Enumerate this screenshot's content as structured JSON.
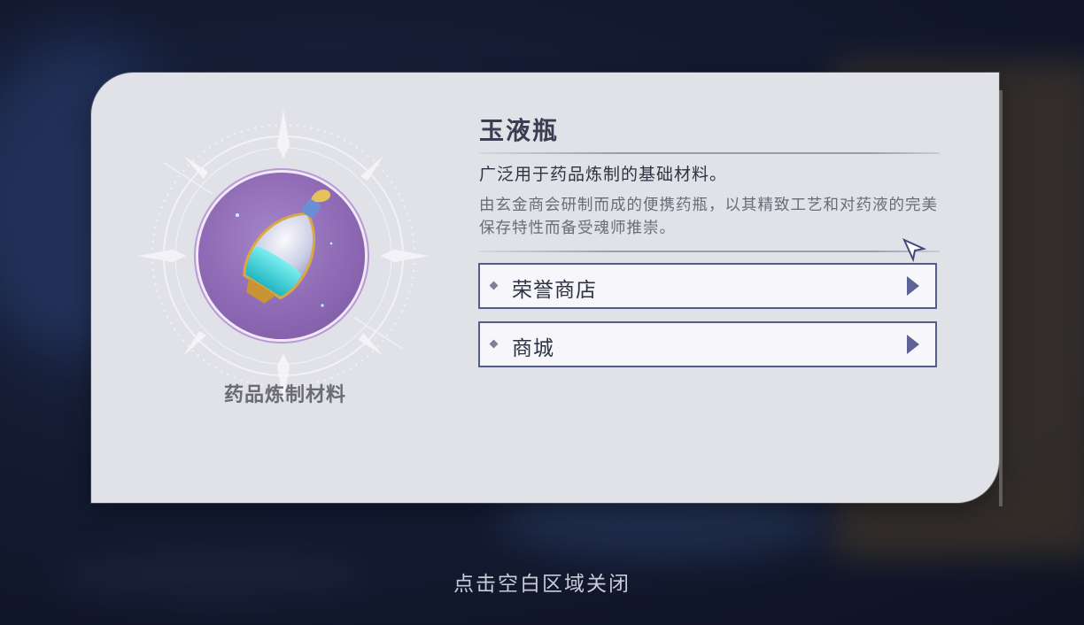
{
  "item": {
    "name": "玉液瓶",
    "category": "药品炼制材料",
    "summary": "广泛用于药品炼制的基础材料。",
    "description": "由玄金商会研制而成的便携药瓶，以其精致工艺和对药液的完美保存特性而备受魂师推崇。",
    "icon": "potion-bottle-icon"
  },
  "sources": [
    {
      "label": "荣誉商店"
    },
    {
      "label": "商城"
    }
  ],
  "hint": {
    "close": "点击空白区域关闭"
  },
  "colors": {
    "panel": "#e1e2e8",
    "button_border": "#555c8a",
    "icon_bg": "#8e69b4",
    "potion_liquid": "#4ad0d6",
    "gold": "#d8a843"
  }
}
